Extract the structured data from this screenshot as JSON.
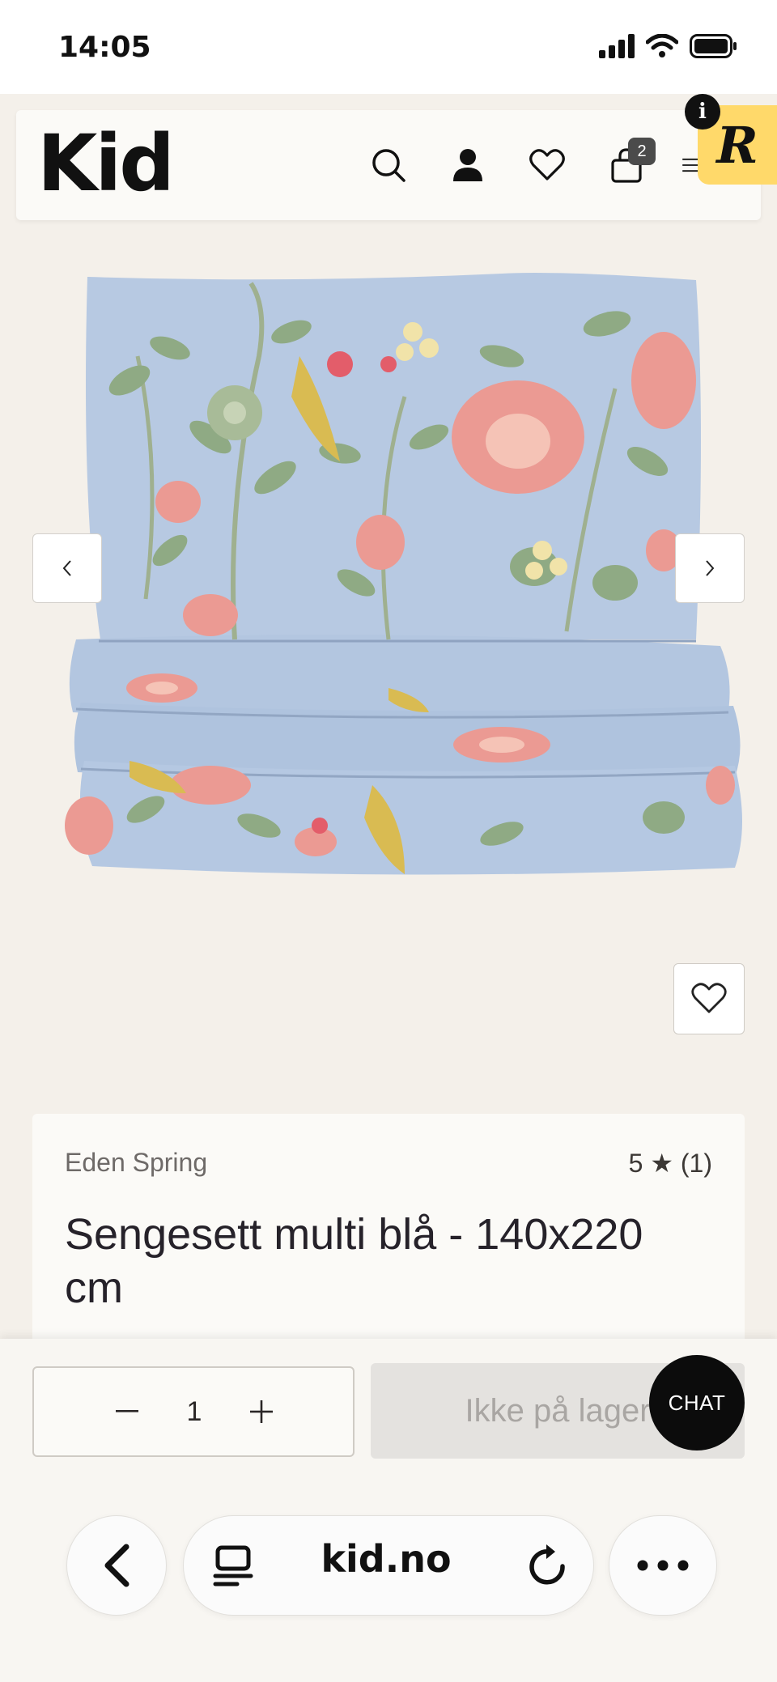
{
  "status_bar": {
    "time": "14:05"
  },
  "header": {
    "logo": "Kid",
    "cart_count": "2",
    "icons": [
      "search-icon",
      "account-icon",
      "heart-icon",
      "cart-icon",
      "menu-icon"
    ],
    "r_badge": "R",
    "info_badge": "i"
  },
  "product": {
    "brand": "Eden Spring",
    "rating": "5 ★ (1)",
    "title": "Sengesett multi blå - 140x220 cm",
    "image_alt": "Floral duvet set in light blue"
  },
  "actions": {
    "quantity": "1",
    "stock_button": "Ikke på lager",
    "chat_label": "CHAT"
  },
  "browser": {
    "url": "kid.no"
  },
  "colors": {
    "page_bg": "#f4f0ea",
    "card_bg": "#fbfaf7",
    "badge_yellow": "#ffd96a",
    "fabric_blue": "#b7c9e2",
    "leaf_green": "#8faa84",
    "flower_pink": "#eb9a93"
  }
}
